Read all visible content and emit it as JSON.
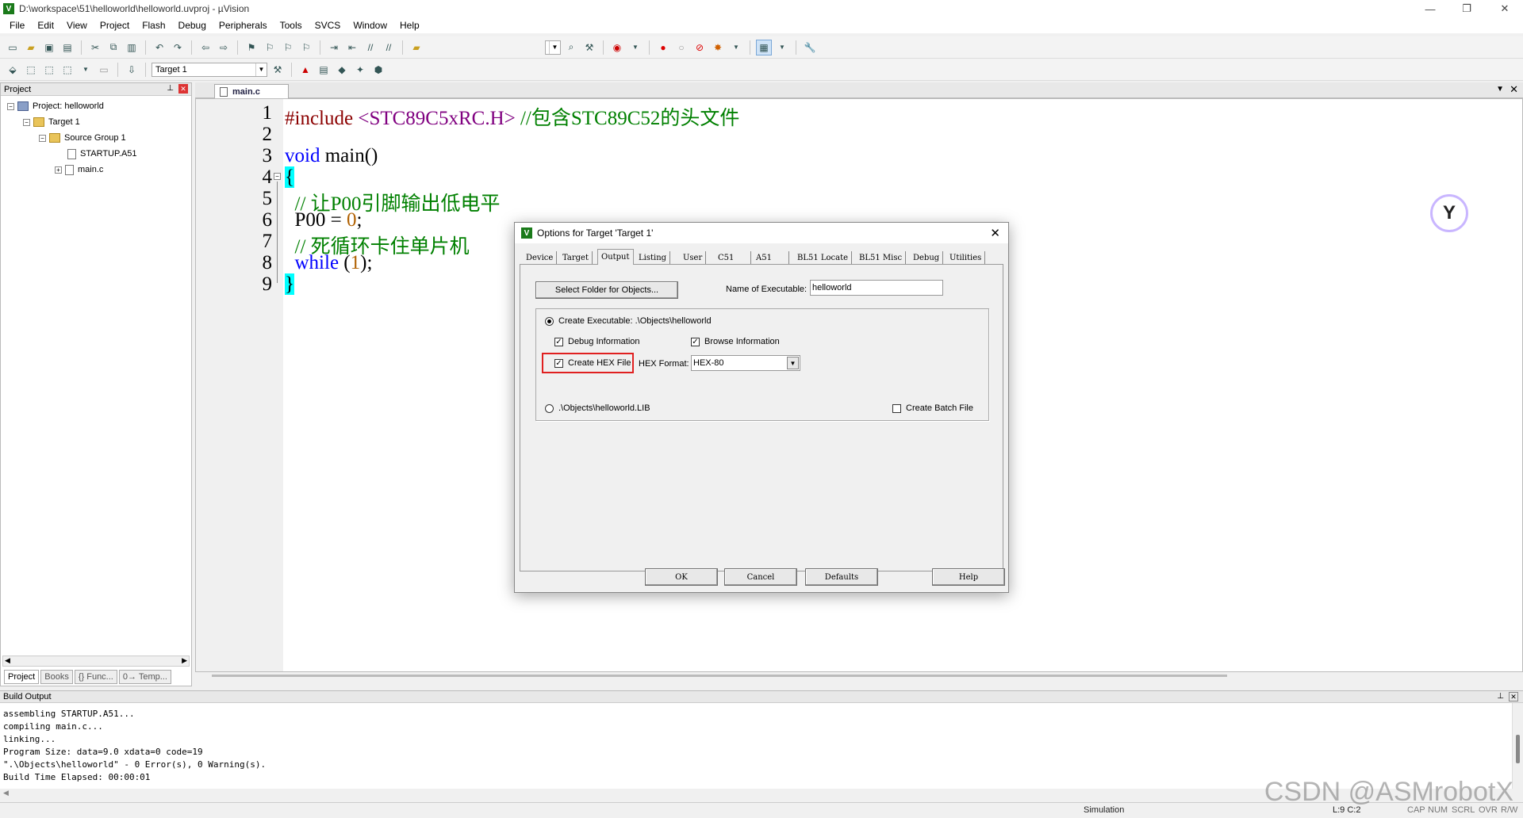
{
  "window": {
    "title": "D:\\workspace\\51\\helloworld\\helloworld.uvproj - µVision",
    "app_icon": "V",
    "controls": [
      "—",
      "❐",
      "✕"
    ]
  },
  "menu": [
    "File",
    "Edit",
    "View",
    "Project",
    "Flash",
    "Debug",
    "Peripherals",
    "Tools",
    "SVCS",
    "Window",
    "Help"
  ],
  "toolbar": {
    "target_select": "Target 1"
  },
  "project_panel": {
    "title": "Project",
    "tree": {
      "project": "Project: helloworld",
      "target": "Target 1",
      "group": "Source Group 1",
      "files": [
        "STARTUP.A51",
        "main.c"
      ]
    },
    "tabs": [
      "Project",
      "Books",
      "{} Func...",
      "0→ Temp..."
    ]
  },
  "editor": {
    "tab": "main.c",
    "line_numbers": [
      "1",
      "2",
      "3",
      "4",
      "5",
      "6",
      "7",
      "8",
      "9"
    ],
    "lines": {
      "l1_pp": "#include",
      "l1_hdr": " <STC89C5xRC.H>",
      "l1_cm": " //包含STC89C52的头文件",
      "l3_kw": "void",
      "l3_rest": " main()",
      "l4": "{",
      "l5": "  // 让P00引脚输出低电平",
      "l6_a": "  P00 = ",
      "l6_num": "0",
      "l6_b": ";",
      "l7": "  // 死循环卡住单片机",
      "l8_kw": "  while",
      "l8_a": " (",
      "l8_num": "1",
      "l8_b": ");",
      "l9": "}"
    }
  },
  "dialog": {
    "title": "Options for Target 'Target 1'",
    "tabs": [
      "Device",
      "Target",
      "Output",
      "Listing",
      "User",
      "C51",
      "A51",
      "BL51 Locate",
      "BL51 Misc",
      "Debug",
      "Utilities"
    ],
    "active_tab": "Output",
    "select_folder_btn": "Select Folder for Objects...",
    "name_label": "Name of Executable:",
    "name_value": "helloworld",
    "create_exe": "Create Executable:  .\\Objects\\helloworld",
    "debug_info": "Debug Information",
    "browse_info": "Browse Information",
    "create_hex": "Create HEX File",
    "hex_format_label": "HEX Format:",
    "hex_format_value": "HEX-80",
    "create_lib": ".\\Objects\\helloworld.LIB",
    "create_batch": "Create Batch File",
    "buttons": {
      "ok": "OK",
      "cancel": "Cancel",
      "defaults": "Defaults",
      "help": "Help"
    },
    "highlight_color": "#e02020"
  },
  "build_output": {
    "title": "Build Output",
    "lines": [
      "assembling STARTUP.A51...",
      "compiling main.c...",
      "linking...",
      "Program Size: data=9.0 xdata=0 code=19",
      "\".\\Objects\\helloworld\" - 0 Error(s), 0 Warning(s).",
      "Build Time Elapsed:  00:00:01"
    ]
  },
  "status": {
    "mode": "Simulation",
    "position": "L:9 C:2",
    "indicators": [
      "CAP",
      "NUM",
      "SCRL",
      "OVR",
      "R/W"
    ]
  },
  "watermark": "CSDN @ASMrobotX"
}
